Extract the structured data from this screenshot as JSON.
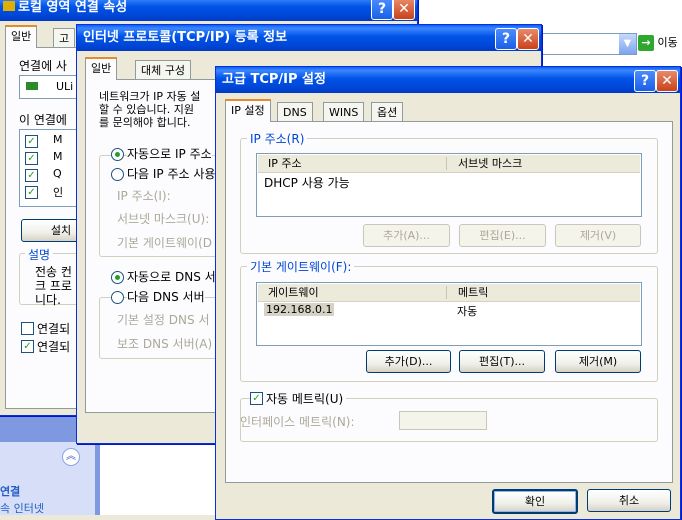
{
  "back_window": {
    "title": "로컬 영역 연결 속성",
    "tab_general": "일반",
    "tab_auth_partial": "고",
    "connect_label": "연결에 사",
    "adapter_partial": "ULi",
    "items_label": "이 연결에",
    "items": [
      "M",
      "M",
      "Q",
      "인"
    ],
    "install_button": "설치",
    "desc_legend": "설명",
    "desc_text": [
      "전송 컨",
      "크 프로",
      "니다."
    ],
    "show_icon_check": "연결되",
    "notify_check": "연결되"
  },
  "address_bar": {
    "go_label": "이동"
  },
  "side_panel": {
    "heading": "연결",
    "subtext": "속 인터넷"
  },
  "tcpip_window": {
    "title": "인터넷 프로토콜(TCP/IP) 등록 정보",
    "tab_general": "일반",
    "tab_alt": "대체 구성",
    "intro": [
      "네트워크가 IP 자동 설",
      "할 수 있습니다. 지원",
      "를 문의해야 합니다."
    ],
    "radio_auto_ip": "자동으로 IP 주소",
    "radio_manual_ip": "다음 IP 주소 사용",
    "ip_label": "IP 주소(I):",
    "subnet_label": "서브넷 마스크(U):",
    "gateway_label": "기본 게이트웨이(D",
    "radio_auto_dns": "자동으로 DNS 서",
    "radio_manual_dns": "다음 DNS 서버",
    "pref_dns": "기본 설정 DNS 서",
    "alt_dns": "보조 DNS 서버(A)"
  },
  "adv_window": {
    "title": "고급 TCP/IP 설정",
    "tabs": [
      "IP 설정",
      "DNS",
      "WINS",
      "옵션"
    ],
    "ip_group": "IP 주소(R)",
    "ip_columns": [
      "IP 주소",
      "서브넷 마스크"
    ],
    "ip_rows": [
      [
        "DHCP 사용 가능",
        ""
      ]
    ],
    "ip_add": "추가(A)...",
    "ip_edit": "편집(E)...",
    "ip_remove": "제거(V)",
    "gw_group": "기본 게이트웨이(F):",
    "gw_columns": [
      "게이트웨이",
      "메트릭"
    ],
    "gw_rows": [
      [
        "192.168.0.1",
        "자동"
      ]
    ],
    "gw_add": "추가(D)...",
    "gw_edit": "편집(T)...",
    "gw_remove": "제거(M)",
    "auto_metric": "자동 메트릭(U)",
    "auto_metric_checked": true,
    "iface_metric_label": "인터페이스 메트릭(N):",
    "iface_metric_value": "",
    "ok": "확인",
    "cancel": "취소"
  },
  "colors": {
    "titlebar": "#0053e8",
    "dialog_bg": "#ece9d8",
    "accent_link": "#0046d5"
  }
}
